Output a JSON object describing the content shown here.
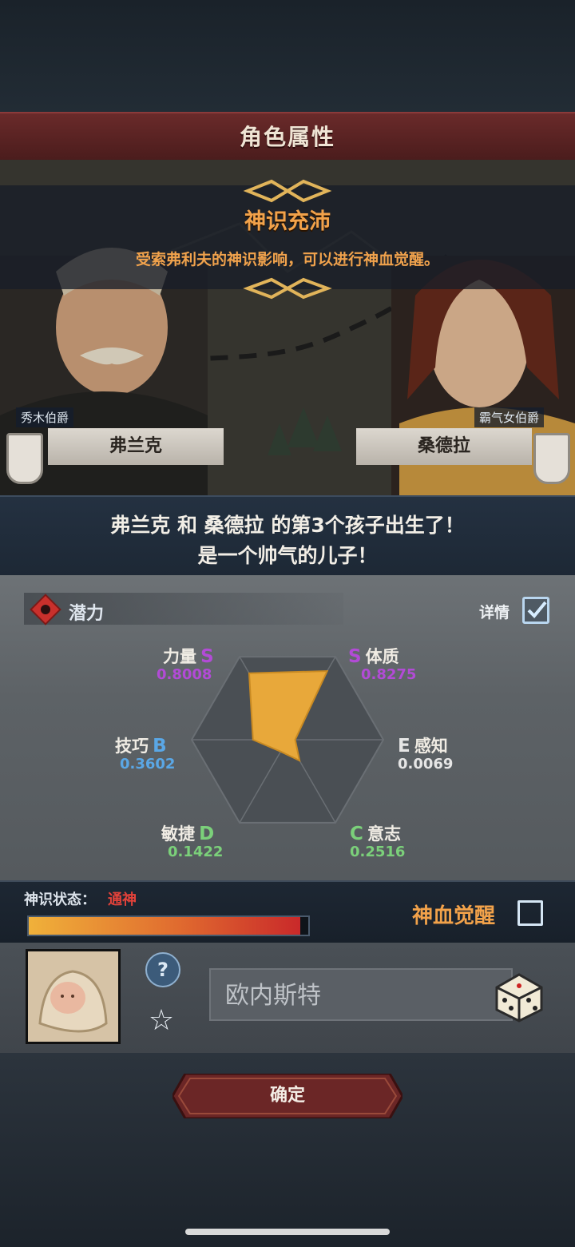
{
  "title": "角色属性",
  "notice": {
    "title": "神识充沛",
    "text": "受索弗利夫的神识影响，可以进行神血觉醒。"
  },
  "father": {
    "title": "秀木伯爵",
    "name": "弗兰克"
  },
  "mother": {
    "title": "霸气女伯爵",
    "name": "桑德拉"
  },
  "announcement": {
    "line1": "弗兰克 和 桑德拉 的第3个孩子出生了！",
    "line2": "是一个帅气的儿子！"
  },
  "potential": {
    "label": "潜力",
    "detail_label": "详情",
    "detail_checked": true,
    "stats": [
      {
        "name": "力量",
        "grade": "S",
        "value": "0.8008",
        "grade_color": "#b24bd6",
        "value_color": "#b24bd6"
      },
      {
        "name": "体质",
        "grade": "S",
        "value": "0.8275",
        "grade_color": "#b24bd6",
        "value_color": "#b24bd6"
      },
      {
        "name": "感知",
        "grade": "E",
        "value": "0.0069",
        "grade_color": "#e6e6e6",
        "value_color": "#e6e6e6"
      },
      {
        "name": "意志",
        "grade": "C",
        "value": "0.2516",
        "grade_color": "#7bd07a",
        "value_color": "#7bd07a"
      },
      {
        "name": "敏捷",
        "grade": "D",
        "value": "0.1422",
        "grade_color": "#7bd07a",
        "value_color": "#7bd07a"
      },
      {
        "name": "技巧",
        "grade": "B",
        "value": "0.3602",
        "grade_color": "#5aa7e6",
        "value_color": "#5aa7e6"
      }
    ]
  },
  "divine": {
    "status_label": "神识状态：",
    "status_value": "通神",
    "progress": 0.97,
    "awaken_label": "神血觉醒",
    "awaken_checked": false
  },
  "naming": {
    "name_value": "欧内斯特",
    "help_icon": "question-icon",
    "favorite_icon": "star-plus-icon",
    "random_icon": "dice-icon"
  },
  "confirm_label": "确定",
  "colors": {
    "accent_orange": "#f2a24a",
    "banner_red": "#6a2a2a",
    "radar_fill": "#e8a83a"
  }
}
